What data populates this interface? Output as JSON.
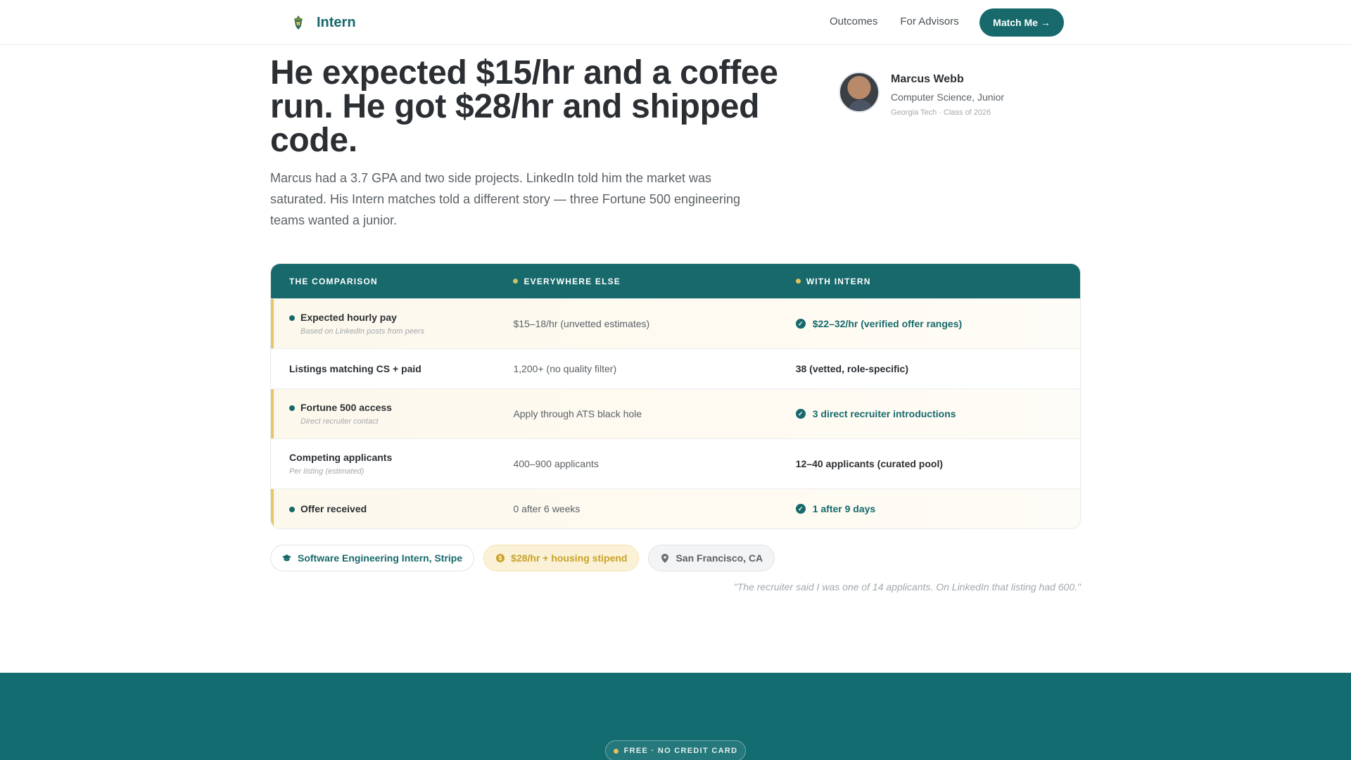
{
  "nav": {
    "brand": "Intern",
    "links": [
      "Outcomes",
      "For Advisors"
    ],
    "cta": "Match Me →"
  },
  "hero": {
    "headline": "He expected $15/hr and a coffee run. He got $28/hr and shipped code.",
    "subtext": "Marcus had a 3.7 GPA and two side projects. LinkedIn told him the market was saturated. His Intern matches told a different story — three Fortune 500 engineering teams wanted a junior."
  },
  "profile": {
    "name": "Marcus Webb",
    "major": "Computer Science, Junior",
    "school": "Georgia Tech · Class of 2026"
  },
  "comparison": {
    "headers": [
      "THE COMPARISON",
      "EVERYWHERE ELSE",
      "WITH INTERN"
    ],
    "header_dot_colors": [
      "#c7c26a",
      "#e2c25b"
    ],
    "rows": [
      {
        "label": "Expected hourly pay",
        "sub": "Based on LinkedIn posts from peers",
        "else": "$15–18/hr (unvetted estimates)",
        "intern": "$22–32/hr (verified offer ranges)"
      },
      {
        "label": "Listings matching CS + paid",
        "sub": "",
        "else": "1,200+ (no quality filter)",
        "intern": "38 (vetted, role-specific)"
      },
      {
        "label": "Fortune 500 access",
        "sub": "Direct recruiter contact",
        "else": "Apply through ATS black hole",
        "intern": "3 direct recruiter introductions"
      },
      {
        "label": "Competing applicants",
        "sub": "Per listing (estimated)",
        "else": "400–900 applicants",
        "intern": "12–40 applicants (curated pool)"
      },
      {
        "label": "Offer received",
        "sub": "",
        "else": "0 after 6 weeks",
        "intern": "1 after 9 days"
      }
    ]
  },
  "tags": {
    "role": "Software Engineering Intern, Stripe",
    "pay": "$28/hr + housing stipend",
    "location": "San Francisco, CA"
  },
  "quote": "\"The recruiter said I was one of 14 applicants. On LinkedIn that listing had 600.\"",
  "footer": {
    "badge": "FREE · NO CREDIT CARD"
  },
  "colors": {
    "brand": "#17696b",
    "highlight": "#e7c56a",
    "band": "#136d70"
  }
}
